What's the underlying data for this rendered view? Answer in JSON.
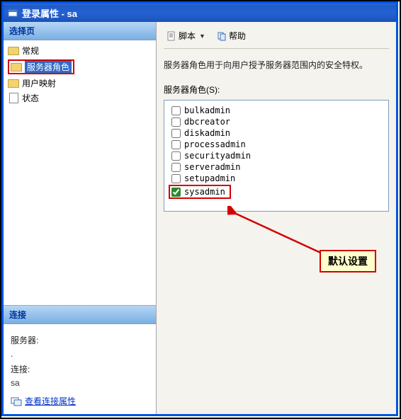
{
  "window": {
    "title": "登录属性 - sa"
  },
  "sidebar": {
    "select_header": "选择页",
    "items": [
      {
        "label": "常规"
      },
      {
        "label": "服务器角色"
      },
      {
        "label": "用户映射"
      },
      {
        "label": "状态"
      }
    ],
    "connection_header": "连接",
    "server_label": "服务器:",
    "server_value": ".",
    "conn_label": "连接:",
    "conn_value": "sa",
    "view_conn_link": "查看连接属性"
  },
  "toolbar": {
    "script_label": "脚本",
    "help_label": "帮助"
  },
  "main": {
    "description": "服务器角色用于向用户授予服务器范围内的安全特权。",
    "roles_label": "服务器角色(S):",
    "roles": [
      {
        "name": "bulkadmin",
        "checked": false
      },
      {
        "name": "dbcreator",
        "checked": false
      },
      {
        "name": "diskadmin",
        "checked": false
      },
      {
        "name": "processadmin",
        "checked": false
      },
      {
        "name": "securityadmin",
        "checked": false
      },
      {
        "name": "serveradmin",
        "checked": false
      },
      {
        "name": "setupadmin",
        "checked": false
      },
      {
        "name": "sysadmin",
        "checked": true
      }
    ]
  },
  "annotation": {
    "text": "默认设置"
  },
  "colors": {
    "highlight": "#d40000",
    "title_bar": "#1e5bc7"
  }
}
